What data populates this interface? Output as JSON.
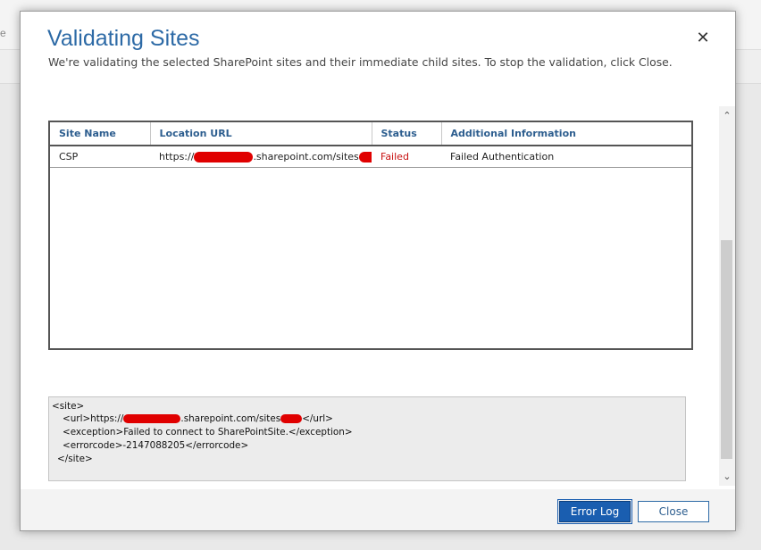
{
  "background": {
    "letter": "e"
  },
  "dialog": {
    "title": "Validating Sites",
    "subtitle": "We're validating the selected SharePoint sites and their immediate child sites. To stop the validation, click Close.",
    "close_glyph": "✕"
  },
  "table": {
    "columns": [
      "Site Name",
      "Location URL",
      "Status",
      "Additional Information"
    ],
    "rows": [
      {
        "site_name": "CSP",
        "url_prefix": "https://",
        "url_middle": ".sharepoint.com/sites",
        "status": "Failed",
        "info": "Failed Authentication"
      }
    ]
  },
  "log": {
    "line1": "<site>",
    "line2_a": "<url>https://",
    "line2_b": ".sharepoint.com/sites",
    "line2_c": "</url>",
    "line3": "<exception>Failed to connect to SharePointSite.</exception>",
    "line4": "<errorcode>-2147088205</errorcode>",
    "line5": "</site>"
  },
  "scrollbar": {
    "up": "⌃",
    "down": "⌄"
  },
  "footer": {
    "error_log_label": "Error Log",
    "close_label": "Close"
  },
  "colors": {
    "accent": "#2d6aa6",
    "primary_button": "#1a5eb0",
    "failed": "#c81010",
    "redaction": "#e00000"
  }
}
